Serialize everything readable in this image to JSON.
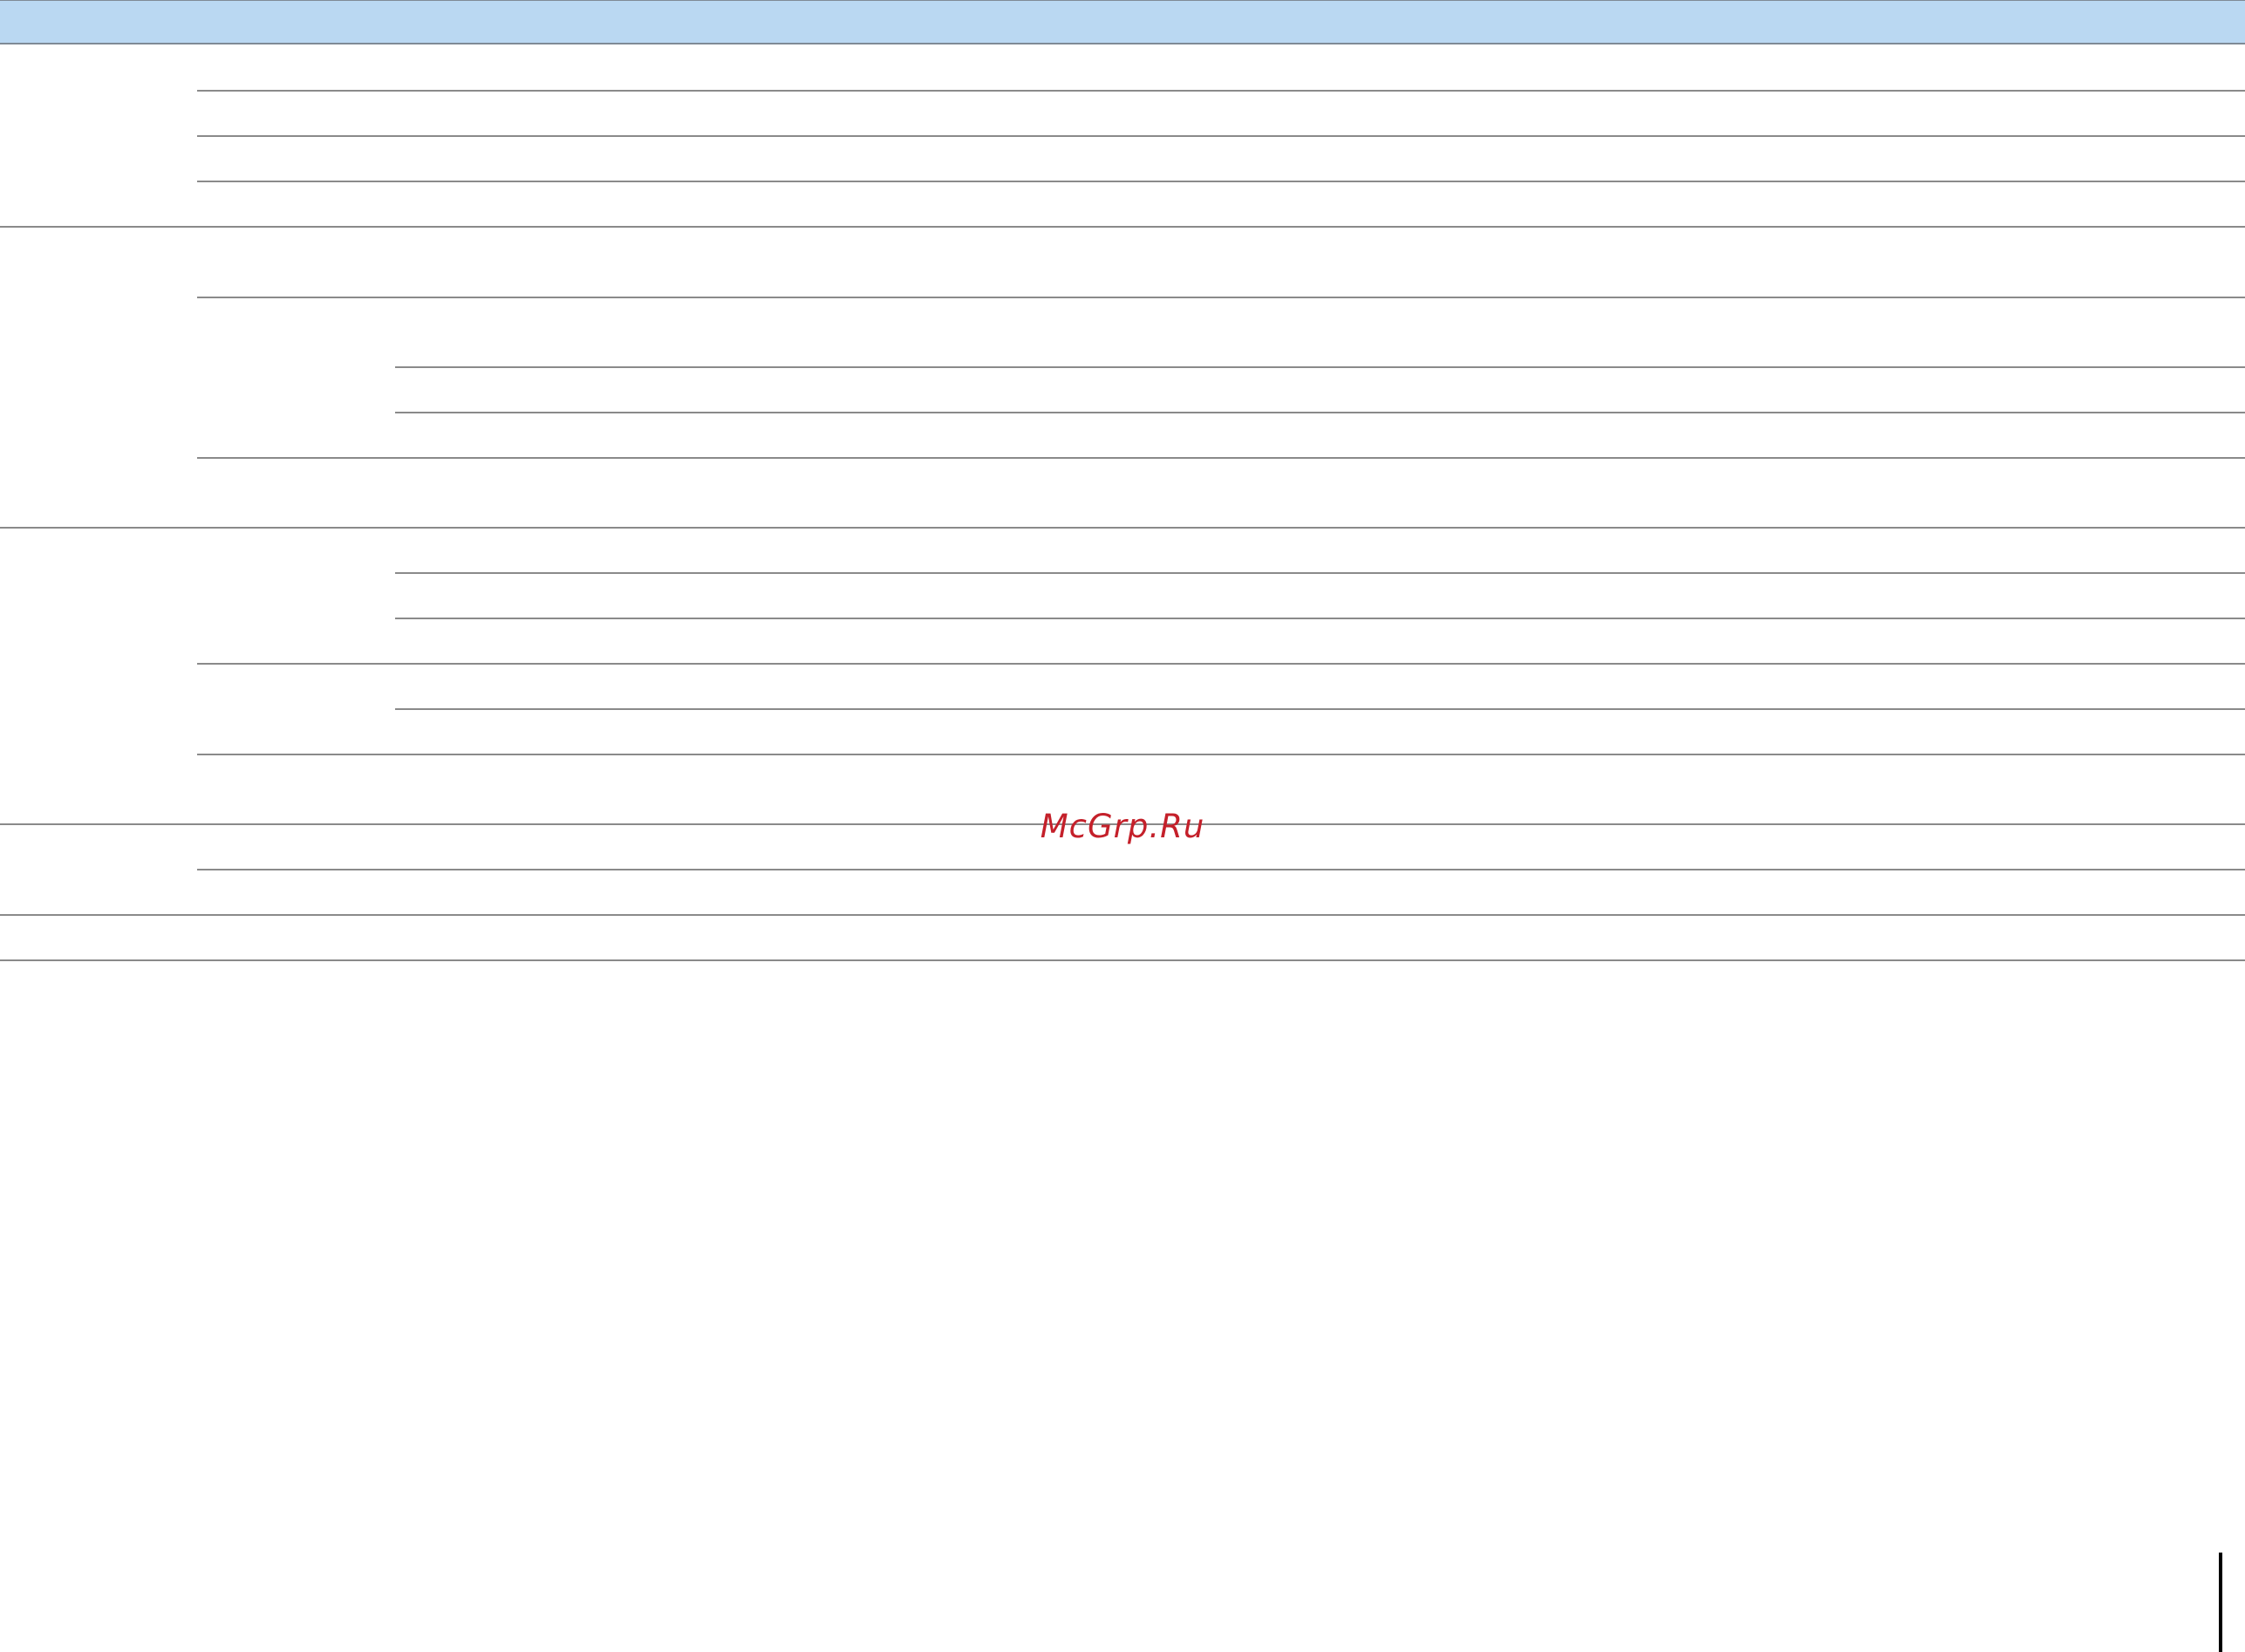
{
  "header": {
    "band_color": "#bad8f2"
  },
  "table": {
    "rule_color": "#8a8a8a"
  },
  "watermark": {
    "text": "McGrp.Ru",
    "color": "#c4202a"
  }
}
